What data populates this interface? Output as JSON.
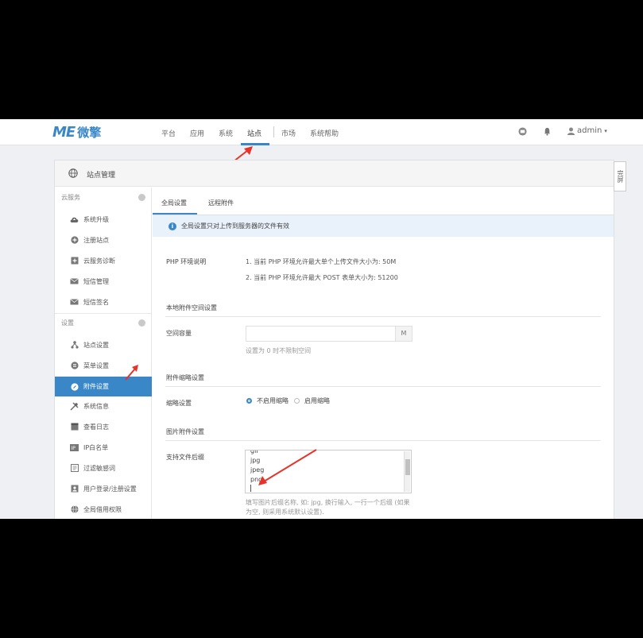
{
  "brand": {
    "logo_mark": "ME",
    "logo_name": "微擎"
  },
  "topnav": {
    "items": [
      {
        "label": "平台"
      },
      {
        "label": "应用"
      },
      {
        "label": "系统"
      },
      {
        "label": "站点",
        "active": true
      },
      {
        "label": "市场"
      },
      {
        "label": "系统帮助"
      }
    ],
    "user": "admin"
  },
  "panel": {
    "title": "站点管理",
    "side_tab": "完屏"
  },
  "sidebar": {
    "sections": [
      {
        "title": "云服务",
        "items": [
          {
            "label": "系统升级",
            "icon": "cloud-up-icon"
          },
          {
            "label": "注册站点",
            "icon": "plus-circle-icon"
          },
          {
            "label": "云服务诊断",
            "icon": "plus-square-icon"
          },
          {
            "label": "短信管理",
            "icon": "envelope-icon"
          },
          {
            "label": "短信签名",
            "icon": "envelope-icon"
          }
        ]
      },
      {
        "title": "设置",
        "items": [
          {
            "label": "站点设置",
            "icon": "sitemap-icon"
          },
          {
            "label": "菜单设置",
            "icon": "list-icon"
          },
          {
            "label": "附件设置",
            "icon": "paperclip-icon",
            "active": true
          },
          {
            "label": "系统信息",
            "icon": "tools-icon"
          },
          {
            "label": "查看日志",
            "icon": "log-icon"
          },
          {
            "label": "IP白名单",
            "icon": "ip-icon"
          },
          {
            "label": "过滤敏感词",
            "icon": "filter-icon"
          },
          {
            "label": "用户登录/注册设置",
            "icon": "user-icon"
          },
          {
            "label": "全局借用权限",
            "icon": "globe-icon"
          }
        ]
      }
    ]
  },
  "main": {
    "tabs": [
      {
        "label": "全局设置",
        "active": true
      },
      {
        "label": "远程附件"
      }
    ],
    "notice": "全局设置只对上传到服务器的文件有效",
    "php_env": {
      "label": "PHP 环境说明",
      "line1": "1. 当前 PHP 环境允许最大单个上传文件大小为: 50M",
      "line2": "2. 当前 PHP 环境允许最大 POST 表单大小为: 51200"
    },
    "local_space": {
      "group_title": "本地附件空间设置",
      "label": "空间容量",
      "value": "",
      "unit": "M",
      "hint": "设置为 0 时不限制空间"
    },
    "thumb": {
      "group_title": "附件缩略设置",
      "label": "缩略设置",
      "options": [
        {
          "label": "不启用缩略",
          "checked": true
        },
        {
          "label": "启用缩略",
          "checked": false
        }
      ]
    },
    "image": {
      "group_title": "图片附件设置",
      "label": "支持文件后缀",
      "extensions": [
        "gif",
        "jpg",
        "jpeg",
        "png"
      ],
      "hint_line1": "填写图片后缀名称, 如: jpg, 换行输入, 一行一个后缀 (如果",
      "hint_line2": "为空, 则采用系统默认设置)."
    }
  },
  "colors": {
    "accent": "#3a87c8",
    "annotation_arrow": "#e8332a"
  }
}
